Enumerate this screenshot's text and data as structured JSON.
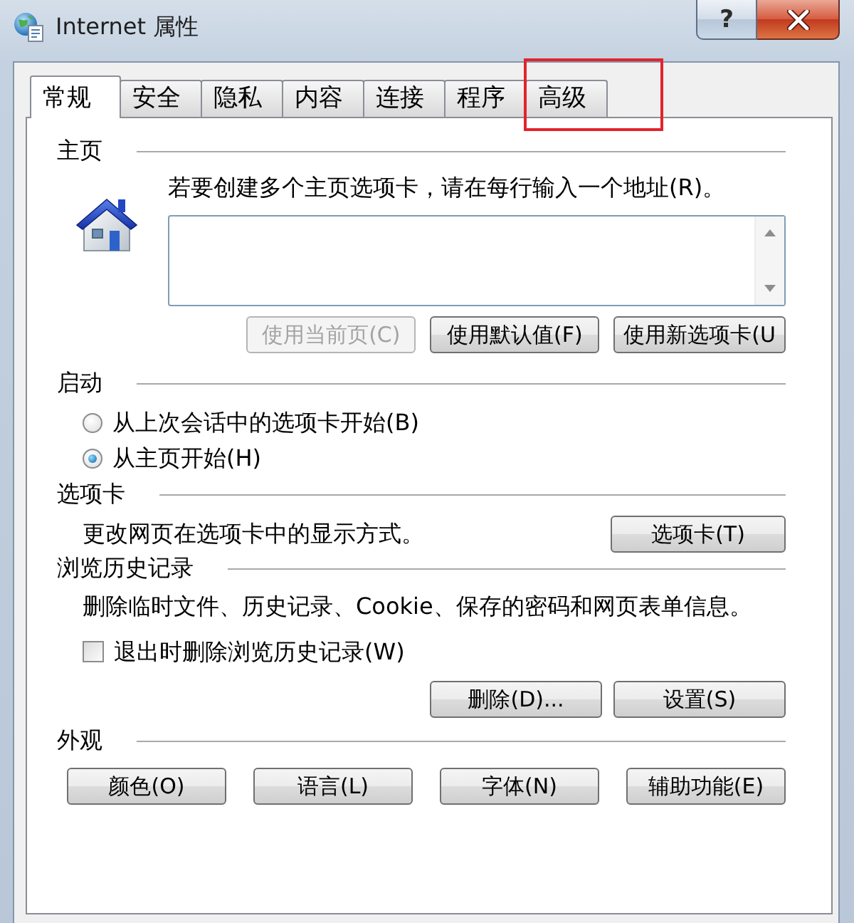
{
  "window": {
    "title": "Internet 属性",
    "help_label": "?"
  },
  "tabs": [
    {
      "label": "常规",
      "selected": true,
      "highlighted": false
    },
    {
      "label": "安全",
      "selected": false,
      "highlighted": false
    },
    {
      "label": "隐私",
      "selected": false,
      "highlighted": false
    },
    {
      "label": "内容",
      "selected": false,
      "highlighted": false
    },
    {
      "label": "连接",
      "selected": false,
      "highlighted": false
    },
    {
      "label": "程序",
      "selected": false,
      "highlighted": false
    },
    {
      "label": "高级",
      "selected": false,
      "highlighted": true
    }
  ],
  "home_page": {
    "heading": "主页",
    "instruction": "若要创建多个主页选项卡，请在每行输入一个地址(R)。",
    "buttons": [
      {
        "label": "使用当前页(C)",
        "disabled": true
      },
      {
        "label": "使用默认值(F)",
        "disabled": false
      },
      {
        "label": "使用新选项卡(U",
        "disabled": false
      }
    ]
  },
  "startup": {
    "heading": "启动",
    "options": [
      {
        "label": "从上次会话中的选项卡开始(B)",
        "selected": false
      },
      {
        "label": "从主页开始(H)",
        "selected": true
      }
    ]
  },
  "tabs_section": {
    "heading": "选项卡",
    "description": "更改网页在选项卡中的显示方式。",
    "button": "选项卡(T)"
  },
  "history": {
    "heading": "浏览历史记录",
    "description": "删除临时文件、历史记录、Cookie、保存的密码和网页表单信息。",
    "checkbox": {
      "label": "退出时删除浏览历史记录(W)",
      "checked": false
    },
    "buttons": [
      "删除(D)...",
      "设置(S)"
    ]
  },
  "appearance": {
    "heading": "外观",
    "buttons": [
      "颜色(O)",
      "语言(L)",
      "字体(N)",
      "辅助功能(E)"
    ]
  }
}
